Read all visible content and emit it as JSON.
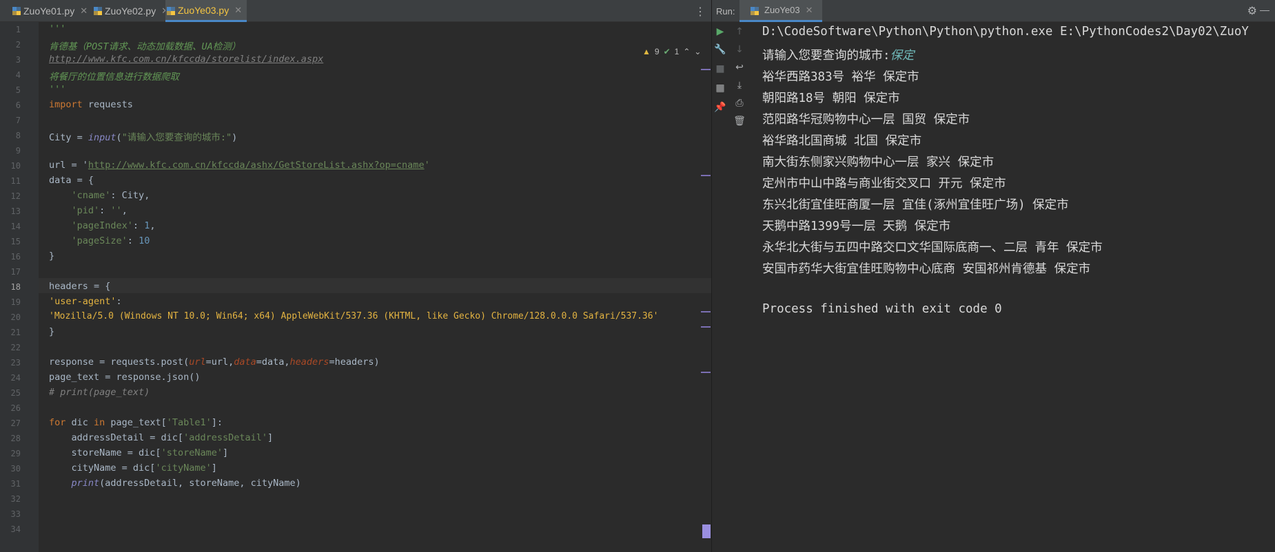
{
  "editor_tabs": [
    {
      "label": "ZuoYe01.py",
      "active": false
    },
    {
      "label": "ZuoYe02.py",
      "active": false
    },
    {
      "label": "ZuoYe03.py",
      "active": true
    }
  ],
  "inspection": {
    "warnings": "9",
    "weak": "1"
  },
  "line_numbers": [
    "1",
    "2",
    "3",
    "4",
    "5",
    "6",
    "7",
    "8",
    "9",
    "10",
    "11",
    "12",
    "13",
    "14",
    "15",
    "16",
    "17",
    "18",
    "19",
    "20",
    "21",
    "22",
    "23",
    "24",
    "25",
    "26",
    "27",
    "28",
    "29",
    "30",
    "31",
    "32",
    "33",
    "34"
  ],
  "code": {
    "doc_open": "'''",
    "doc_line1": "肯德基（POST请求、动态加载数据、UA检测）",
    "doc_url": "http://www.kfc.com.cn/kfccda/storelist/index.aspx",
    "doc_line3": "将餐厅的位置信息进行数据爬取",
    "doc_close": "'''",
    "import_kw": "import",
    "import_mod": " requests",
    "city_lhs": "City = ",
    "city_fn": "input",
    "city_prompt": "\"请输入您要查询的城市:\"",
    "url_lhs": "url = '",
    "url_val": "http://www.kfc.com.cn/kfccda/ashx/GetStoreList.ashx?op=cname",
    "url_end": "'",
    "data_open": "data = {",
    "d_cname_k": "'cname'",
    "d_cname_v": ": City,",
    "d_pid_k": "'pid'",
    "d_pid_v": "''",
    "d_pindex_k": "'pageIndex'",
    "d_pindex_v": "1",
    "d_psize_k": "'pageSize'",
    "d_psize_v": "10",
    "data_close": "}",
    "headers_open": "headers = {",
    "ua_key": "'user-agent'",
    "ua_colon": ":",
    "ua_val": "'Mozilla/5.0 (Windows NT 10.0; Win64; x64) AppleWebKit/537.36 (KHTML, like Gecko) Chrome/128.0.0.0 Safari/537.36'",
    "headers_close": "}",
    "resp_a": "response = requests.post(",
    "resp_p1": "url",
    "resp_b": "=url,",
    "resp_p2": "data",
    "resp_c": "=data,",
    "resp_p3": "headers",
    "resp_d": "=headers)",
    "pagetext": "page_text = response.json()",
    "comment": "# print(page_text)",
    "for_kw": "for",
    "for_a": " dic ",
    "for_in": "in",
    "for_b": " page_text[",
    "for_key": "'Table1'",
    "for_c": "]:",
    "ad_a": "    addressDetail = dic[",
    "ad_key": "'addressDetail'",
    "ad_c": "]",
    "sn_a": "    storeName = dic[",
    "sn_key": "'storeName'",
    "sn_c": "]",
    "cn_a": "    cityName = dic[",
    "cn_key": "'cityName'",
    "cn_c": "]",
    "pr_fn": "print",
    "pr_args": "(addressDetail, storeName, cityName)"
  },
  "run": {
    "label": "Run:",
    "tab": "ZuoYe03",
    "command": "D:\\CodeSoftware\\Python\\Python\\python.exe E:\\PythonCodes2\\Day02\\ZuoY",
    "prompt": "请输入您要查询的城市:",
    "input_value": "保定",
    "output": [
      "裕华西路383号 裕华 保定市",
      "朝阳路18号 朝阳 保定市",
      "范阳路华冠购物中心一层 国贸 保定市",
      "裕华路北国商城 北国 保定市",
      "南大街东侧家兴购物中心一层 家兴 保定市",
      "定州市中山中路与商业街交叉口 开元 保定市",
      "东兴北街宜佳旺商厦一层 宜佳(涿州宜佳旺广场) 保定市",
      "天鹅中路1399号一层 天鹅 保定市",
      "永华北大街与五四中路交口文华国际底商一、二层 青年 保定市",
      "安国市药华大街宜佳旺购物中心底商 安国祁州肯德基 保定市"
    ],
    "finished": "Process finished with exit code 0"
  }
}
